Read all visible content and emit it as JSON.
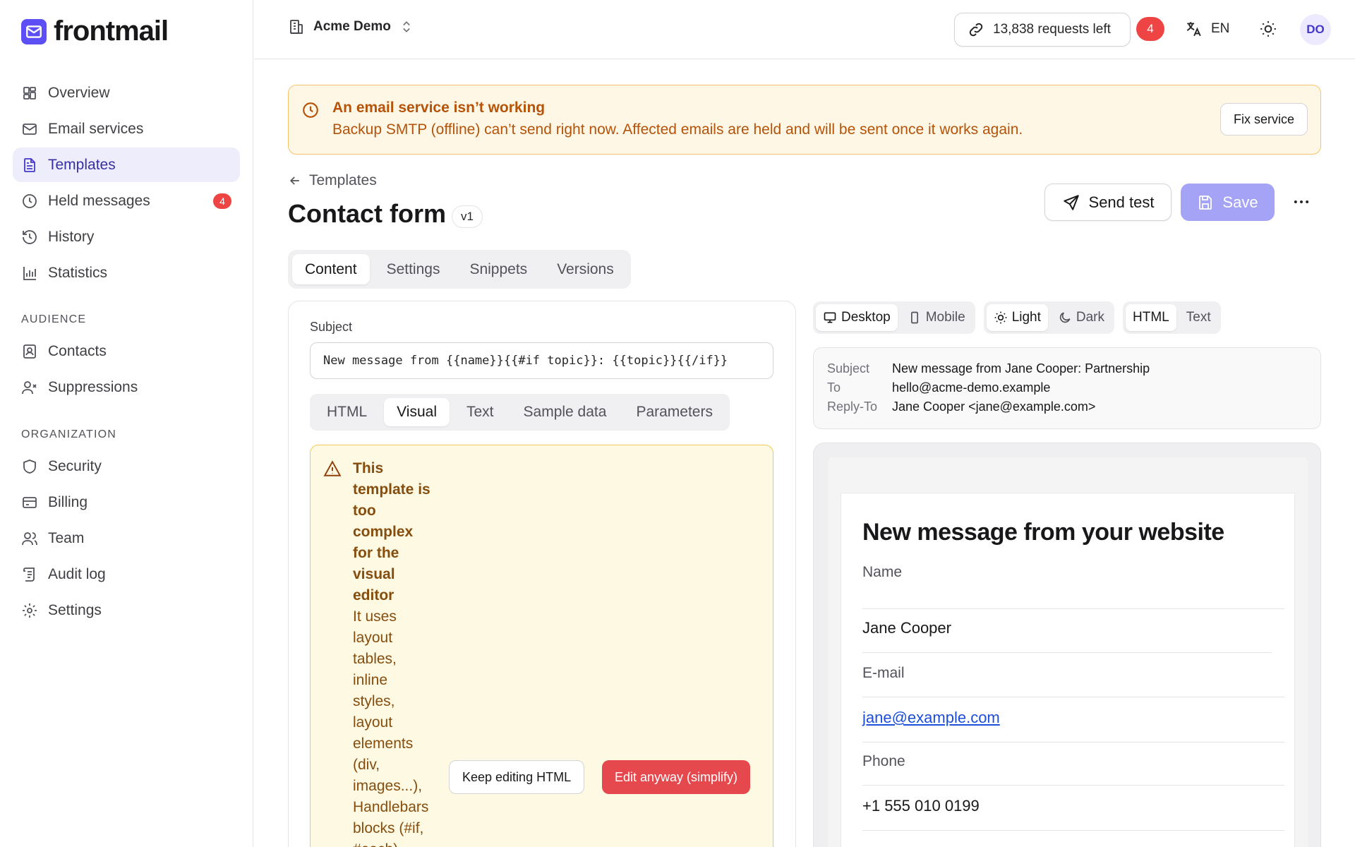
{
  "brand": {
    "name": "frontmail"
  },
  "sidebar": {
    "items": [
      {
        "label": "Overview"
      },
      {
        "label": "Email services"
      },
      {
        "label": "Templates"
      },
      {
        "label": "Held messages",
        "badge": "4"
      },
      {
        "label": "History"
      },
      {
        "label": "Statistics"
      }
    ],
    "audience_heading": "AUDIENCE",
    "audience_items": [
      {
        "label": "Contacts"
      },
      {
        "label": "Suppressions"
      }
    ],
    "organization_heading": "ORGANIZATION",
    "organization_items": [
      {
        "label": "Security"
      },
      {
        "label": "Billing"
      },
      {
        "label": "Team"
      },
      {
        "label": "Audit log"
      },
      {
        "label": "Settings"
      }
    ]
  },
  "topbar": {
    "workspace": "Acme Demo",
    "requests": "13,838 requests left",
    "notification_count": "4",
    "language": "EN",
    "avatar_initials": "DO"
  },
  "alert": {
    "title": "An email service isn’t working",
    "text": "Backup SMTP (offline) can’t send right now. Affected emails are held and will be sent once it works again.",
    "action": "Fix service"
  },
  "page": {
    "back_label": "Templates",
    "title": "Contact form",
    "version": "v1",
    "send_test": "Send test",
    "save": "Save"
  },
  "tabs": [
    "Content",
    "Settings",
    "Snippets",
    "Versions"
  ],
  "editor": {
    "subject_label": "Subject",
    "subject_value": "New message from {{name}}{{#if topic}}: {{topic}}{{/if}}",
    "tabs": [
      "HTML",
      "Visual",
      "Text",
      "Sample data",
      "Parameters"
    ],
    "warning_title": "This template is too complex for the visual editor",
    "warning_text": "It uses layout tables, inline styles, layout elements (div, images...), Handlebars blocks (#if, #each),",
    "keep_editing": "Keep editing HTML",
    "edit_anyway": "Edit anyway (simplify)"
  },
  "preview": {
    "device": [
      "Desktop",
      "Mobile"
    ],
    "theme": [
      "Light",
      "Dark"
    ],
    "format": [
      "HTML",
      "Text"
    ],
    "meta": {
      "subject_key": "Subject",
      "subject": "New message from Jane Cooper: Partnership",
      "to_key": "To",
      "to": "hello@acme-demo.example",
      "reply_key": "Reply-To",
      "reply": "Jane Cooper <jane@example.com>"
    },
    "email": {
      "heading": "New message from your website",
      "name_label": "Name",
      "name_value": "Jane Cooper",
      "email_label": "E-mail",
      "email_value": "jane@example.com",
      "phone_label": "Phone",
      "phone_value": "+1 555 010 0199"
    }
  },
  "colors": {
    "accent": "#5b4ff5",
    "alert_text": "#b45309",
    "danger": "#e5484d",
    "save_disabled": "#a5a3f5"
  }
}
